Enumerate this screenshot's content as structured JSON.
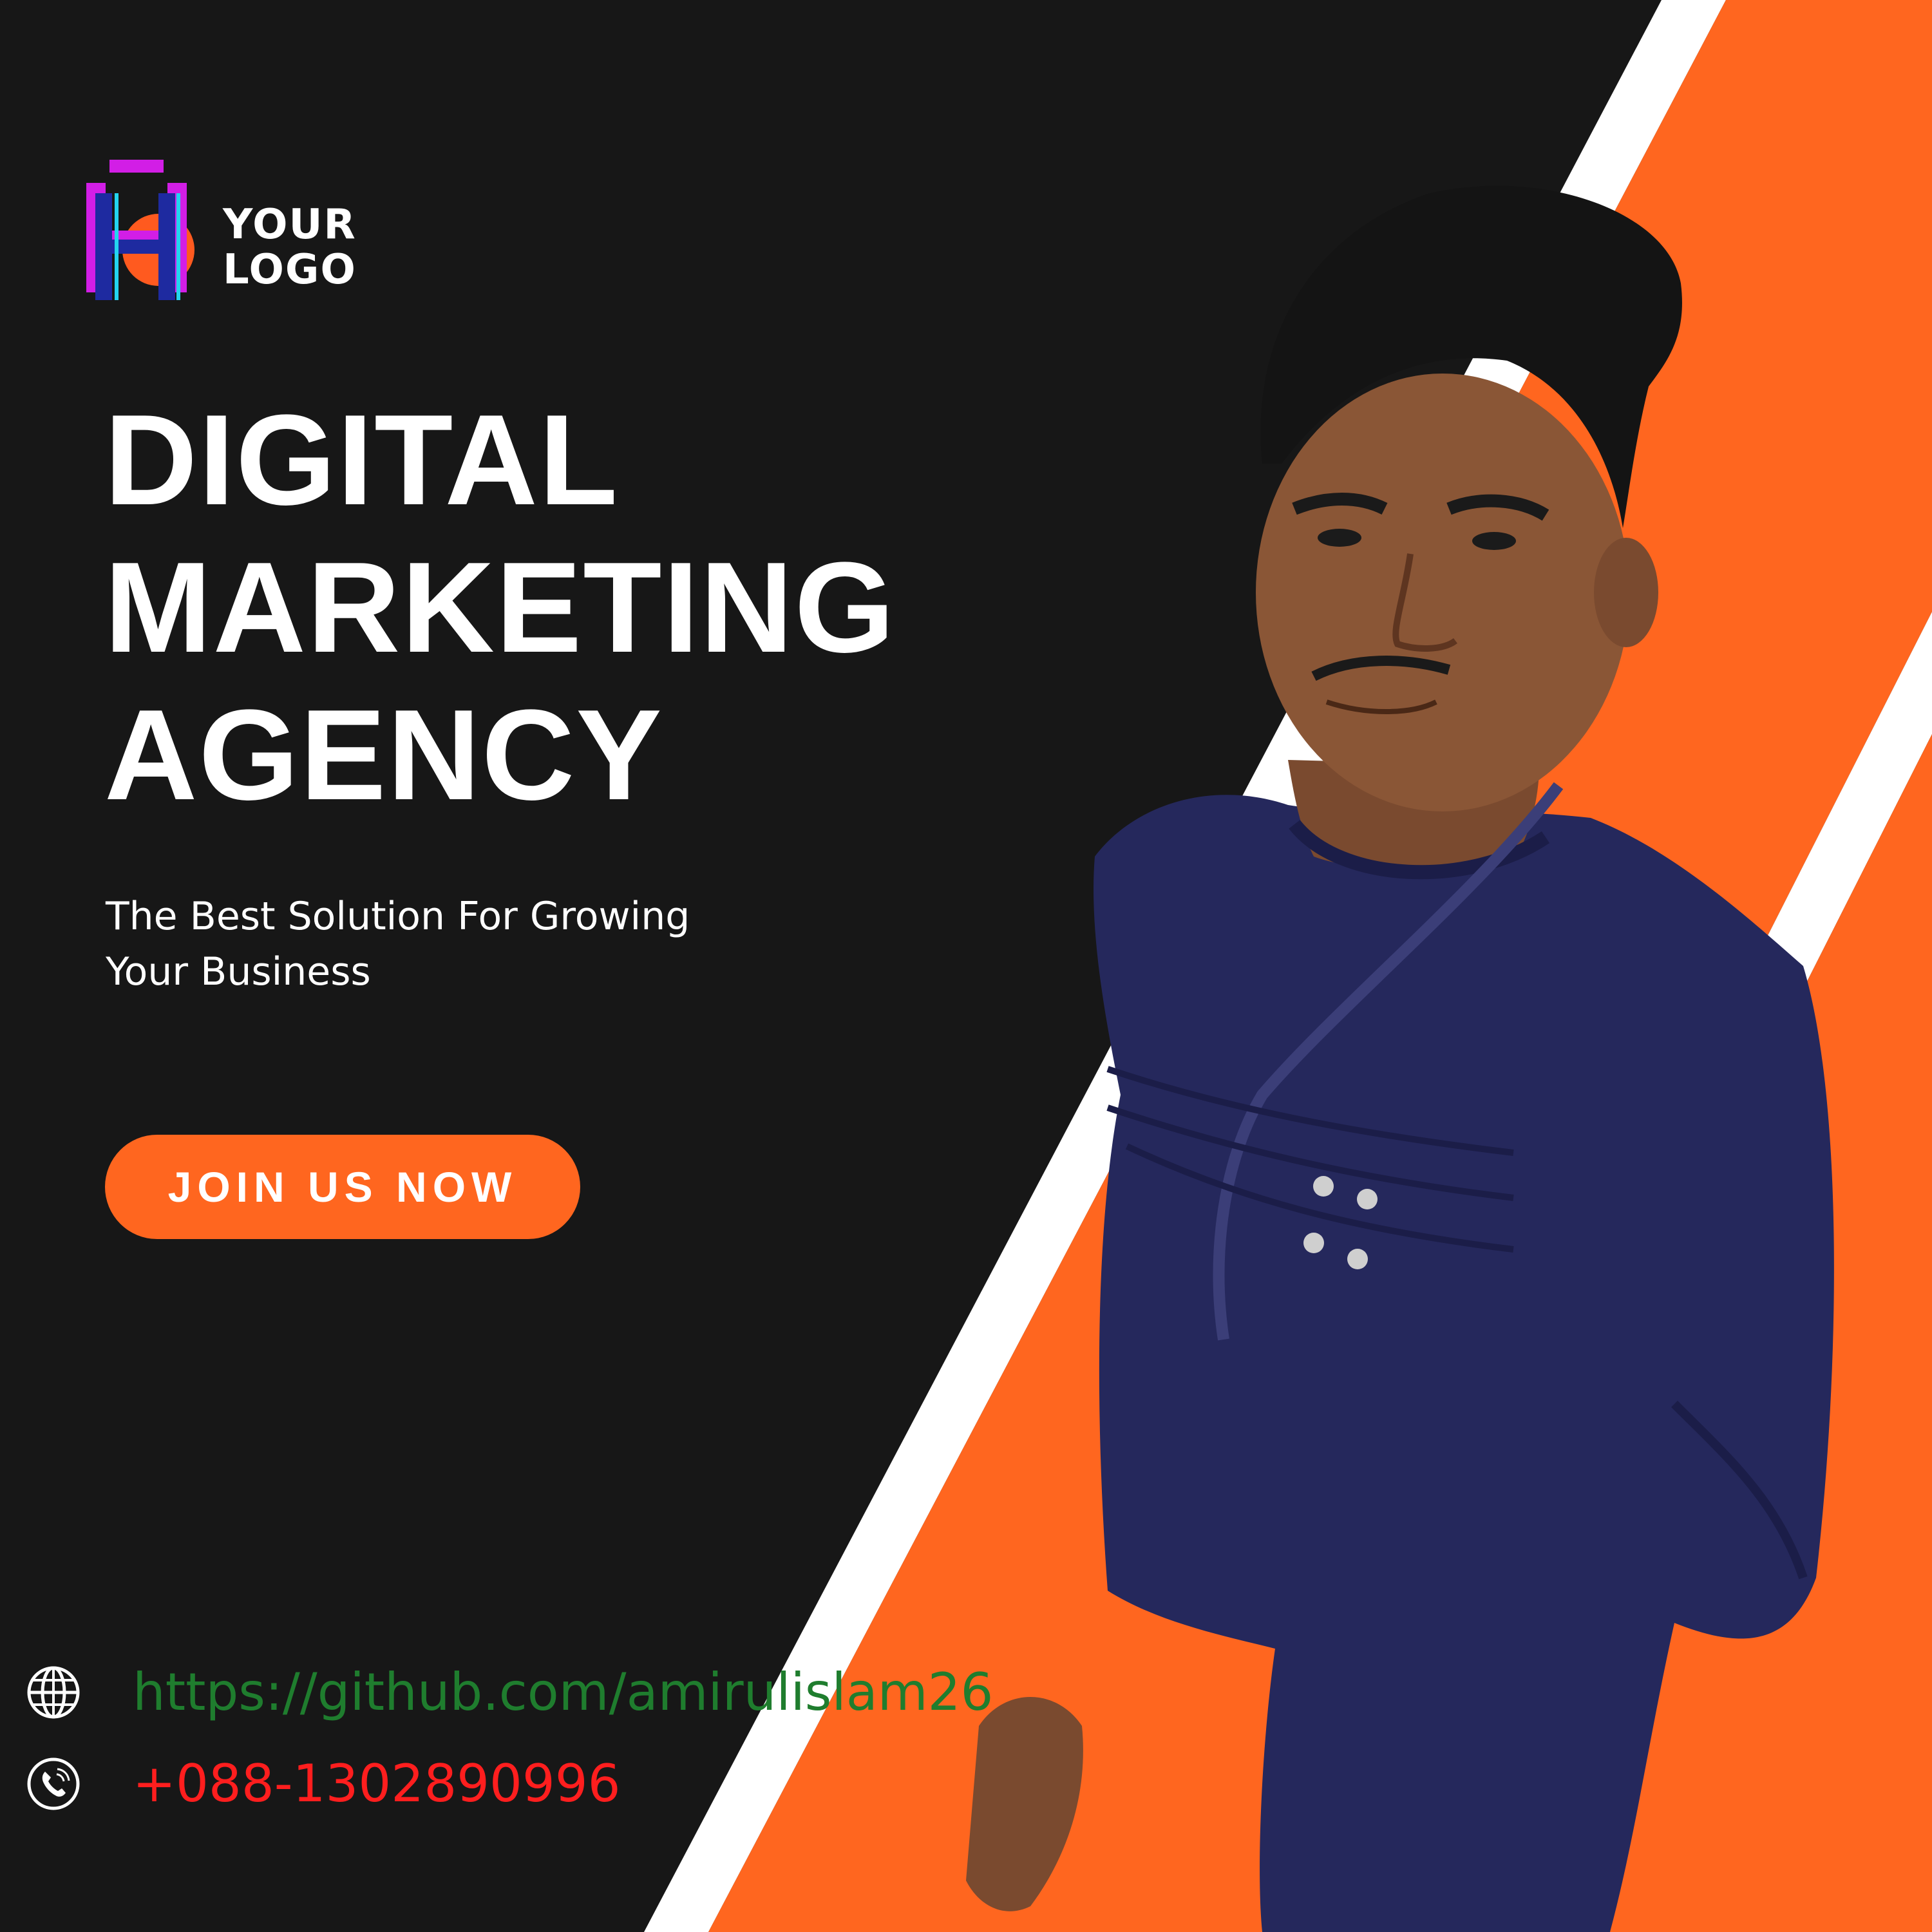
{
  "logo": {
    "line1": "YOUR",
    "line2": "LOGO",
    "icon": "letter-h-logo-icon"
  },
  "headline": {
    "line1": "DIGITAL",
    "line2": "MARKETING",
    "line3": "AGENCY"
  },
  "tagline": {
    "line1": "The Best Solution For Growing",
    "line2": "Your Business"
  },
  "cta": {
    "label": "JOIN US NOW"
  },
  "contact": {
    "website": {
      "icon": "globe-icon",
      "text": "https://github.com/amirulislam26"
    },
    "phone": {
      "icon": "phone-icon",
      "text": "+088-1302890996"
    }
  },
  "colors": {
    "background": "#171717",
    "accent_orange": "#ff661f",
    "stripe_white": "#ffffff",
    "website_text": "#1f7d2e",
    "phone_text": "#ff1e1e",
    "shirt": "#25285c"
  }
}
